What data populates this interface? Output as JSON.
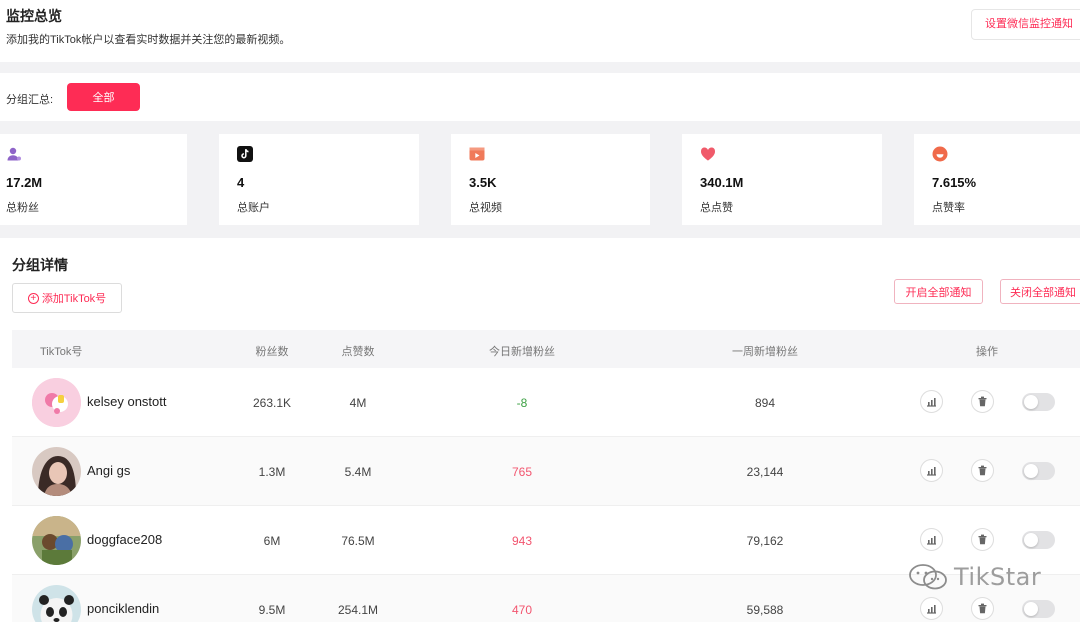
{
  "header": {
    "title": "监控总览",
    "subtitle": "添加我的TikTok帐户以查看实时数据并关注您的最新视频。",
    "wechat_button": "设置微信监控通知"
  },
  "group_bar": {
    "label": "分组汇总:",
    "all_button": "全部"
  },
  "stats": [
    {
      "icon": "fans-user-icon",
      "value": "17.2M",
      "label": "总粉丝",
      "color": "#8e63c8"
    },
    {
      "icon": "tiktok-logo-icon",
      "value": "4",
      "label": "总账户",
      "color": "#111111"
    },
    {
      "icon": "video-icon",
      "value": "3.5K",
      "label": "总视频",
      "color": "#f07a5a"
    },
    {
      "icon": "heart-icon",
      "value": "340.1M",
      "label": "总点赞",
      "color": "#f05a6a"
    },
    {
      "icon": "like-rate-icon",
      "value": "7.615%",
      "label": "点赞率",
      "color": "#f06a4a"
    }
  ],
  "detail": {
    "title": "分组详情",
    "add_button": "添加TikTok号",
    "notify_on_button": "开启全部通知",
    "notify_off_button": "关闭全部通知",
    "columns": [
      "TikTok号",
      "粉丝数",
      "点赞数",
      "今日新增粉丝",
      "一周新增粉丝",
      "操作"
    ],
    "rows": [
      {
        "name": "kelsey onstott",
        "fans": "263.1K",
        "likes": "4M",
        "today": "-8",
        "week": "894",
        "today_trend": "down",
        "toggle_on": false
      },
      {
        "name": "Angi gs",
        "fans": "1.3M",
        "likes": "5.4M",
        "today": "765",
        "week": "23,144",
        "today_trend": "up",
        "toggle_on": false
      },
      {
        "name": "doggface208",
        "fans": "6M",
        "likes": "76.5M",
        "today": "943",
        "week": "79,162",
        "today_trend": "up",
        "toggle_on": false
      },
      {
        "name": "ponciklendin",
        "fans": "9.5M",
        "likes": "254.1M",
        "today": "470",
        "week": "59,588",
        "today_trend": "up",
        "toggle_on": false
      }
    ]
  },
  "watermark": "TikStar",
  "colors": {
    "accent": "#fe2c55",
    "up": "#f2556f",
    "down": "#3ca043"
  }
}
